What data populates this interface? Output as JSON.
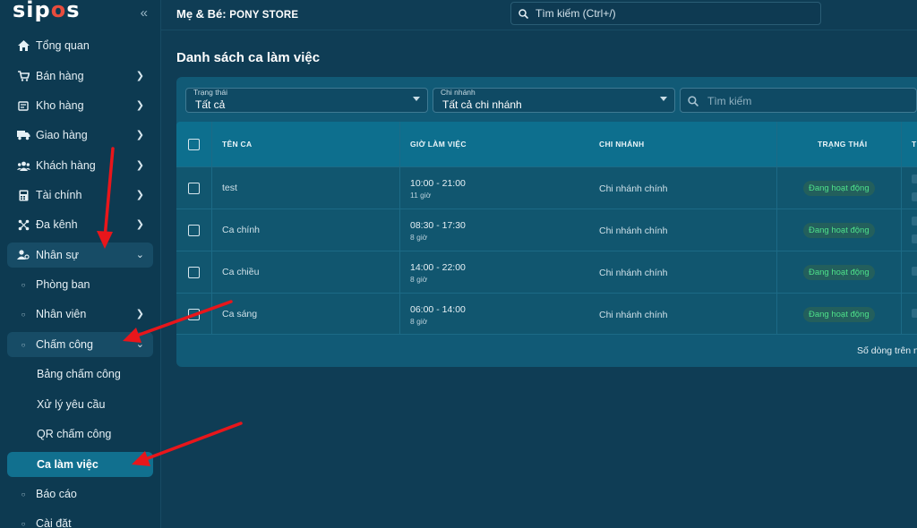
{
  "app": {
    "logo_text": "sipos",
    "collapse_icon": "double-chevron-left-icon"
  },
  "topbar": {
    "store_prefix": "Mẹ & Bé: ",
    "store_name": "PONY STORE",
    "search_placeholder": "Tìm kiếm (Ctrl+/)"
  },
  "sidebar": {
    "items": [
      {
        "label": "Tổng quan",
        "icon": "home-icon"
      },
      {
        "label": "Bán hàng",
        "icon": "cart-icon"
      },
      {
        "label": "Kho hàng",
        "icon": "inventory-icon"
      },
      {
        "label": "Giao hàng",
        "icon": "truck-icon"
      },
      {
        "label": "Khách hàng",
        "icon": "users-icon"
      },
      {
        "label": "Tài chính",
        "icon": "calculator-icon"
      },
      {
        "label": "Đa kênh",
        "icon": "channels-icon"
      },
      {
        "label": "Nhân sự",
        "icon": "staff-icon"
      }
    ],
    "hr_sub": [
      {
        "label": "Phòng ban"
      },
      {
        "label": "Nhân viên"
      },
      {
        "label": "Chấm công"
      }
    ],
    "attendance_sub": [
      {
        "label": "Bảng chấm công"
      },
      {
        "label": "Xử lý yêu cầu"
      },
      {
        "label": "QR chấm công"
      },
      {
        "label": "Ca làm việc"
      }
    ],
    "more": [
      {
        "label": "Báo cáo"
      },
      {
        "label": "Cài đặt"
      }
    ]
  },
  "main": {
    "title": "Danh sách ca làm việc",
    "filters": {
      "status": {
        "label": "Trạng thái",
        "value": "Tất cả"
      },
      "branch": {
        "label": "Chi nhánh",
        "value": "Tất cả chi nhánh"
      },
      "search_placeholder": "Tìm kiếm"
    },
    "table": {
      "columns": [
        "TÊN CA",
        "GIỜ LÀM VIỆC",
        "CHI NHÁNH",
        "TRẠNG THÁI",
        "T"
      ],
      "rows": [
        {
          "name": "test",
          "time": "10:00 - 21:00",
          "hours": "11 giờ",
          "branch": "Chi nhánh chính",
          "status": "Đang hoạt động"
        },
        {
          "name": "Ca chính",
          "time": "08:30 - 17:30",
          "hours": "8 giờ",
          "branch": "Chi nhánh chính",
          "status": "Đang hoạt động"
        },
        {
          "name": "Ca chiều",
          "time": "14:00 - 22:00",
          "hours": "8 giờ",
          "branch": "Chi nhánh chính",
          "status": "Đang hoạt động"
        },
        {
          "name": "Ca sáng",
          "time": "06:00 - 14:00",
          "hours": "8 giờ",
          "branch": "Chi nhánh chính",
          "status": "Đang hoạt động"
        }
      ]
    },
    "footer_text": "Số dòng trên n"
  },
  "colors": {
    "accent": "#11708f",
    "status_green": "#4ee08a",
    "annotation_red": "#e8161b"
  }
}
